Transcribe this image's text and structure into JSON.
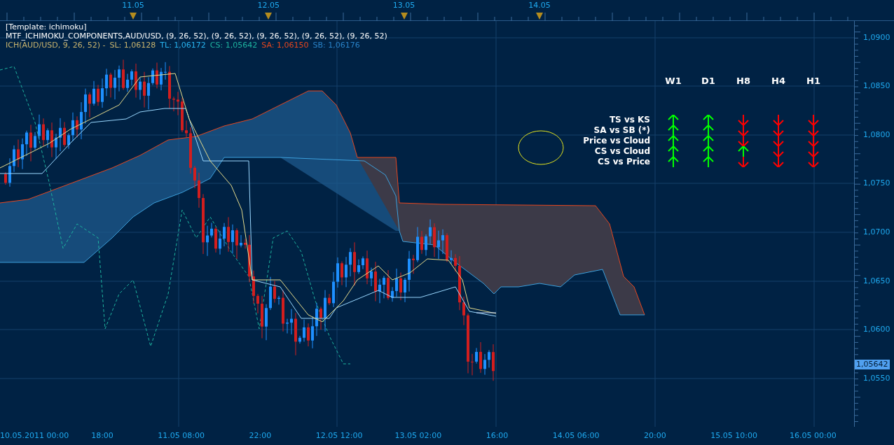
{
  "date_markers": [
    "11.05",
    "12.05",
    "13.05",
    "14.05"
  ],
  "legend": {
    "template": "[Template: ichimoku]",
    "indicator": "MTF_ICHIMOKU_COMPONENTS,AUD/USD, (9, 26, 52), (9, 26, 52), (9, 26, 52), (9, 26, 52), (9, 26, 52)",
    "values": [
      {
        "text": "ICH(AUD/USD, 9, 26, 52) -",
        "color": "#c8b46e"
      },
      {
        "text": "SL: 1,06128",
        "color": "#c8b46e"
      },
      {
        "text": "TL: 1,06172",
        "color": "#28b4f0"
      },
      {
        "text": "CS: 1,05642",
        "color": "#1eb4a0"
      },
      {
        "text": "SA: 1,06150",
        "color": "#e6461e"
      },
      {
        "text": "SB: 1,06176",
        "color": "#2882c8"
      }
    ]
  },
  "signal_table": {
    "columns": [
      "W1",
      "D1",
      "H8",
      "H4",
      "H1"
    ],
    "rows": [
      {
        "label": "TS vs KS",
        "cells": [
          {
            "up": true
          },
          {
            "up": true
          },
          {
            "up": false
          },
          {
            "up": false
          },
          {
            "up": false
          }
        ]
      },
      {
        "label": "SA vs SB (*)",
        "cells": [
          {
            "up": true
          },
          {
            "up": true
          },
          {
            "up": false
          },
          {
            "up": false
          },
          {
            "up": false
          }
        ]
      },
      {
        "label": "Price vs Cloud",
        "cells": [
          {
            "up": true
          },
          {
            "up": true
          },
          {
            "up": false
          },
          {
            "up": false
          },
          {
            "up": false
          }
        ]
      },
      {
        "label": "CS vs Cloud",
        "cells": [
          {
            "up": true
          },
          {
            "up": true
          },
          {
            "up": true
          },
          {
            "up": false
          },
          {
            "up": false
          }
        ]
      },
      {
        "label": "CS vs Price",
        "cells": [
          {
            "up": true
          },
          {
            "up": true
          },
          {
            "up": false
          },
          {
            "up": false
          },
          {
            "up": false
          }
        ]
      }
    ]
  },
  "price_axis": {
    "labels": [
      "1,0900",
      "1,0850",
      "1,0800",
      "1,0750",
      "1,0700",
      "1,0650",
      "1,0600",
      "1,0550"
    ],
    "current_price": "1,05642"
  },
  "time_axis": [
    "10.05.2011 00:00",
    "18:00",
    "11.05 08:00",
    "22:00",
    "12.05 12:00",
    "13.05 02:00",
    "16:00",
    "14.05 06:00",
    "20:00",
    "15.05 10:00",
    "16.05 00:00"
  ]
}
